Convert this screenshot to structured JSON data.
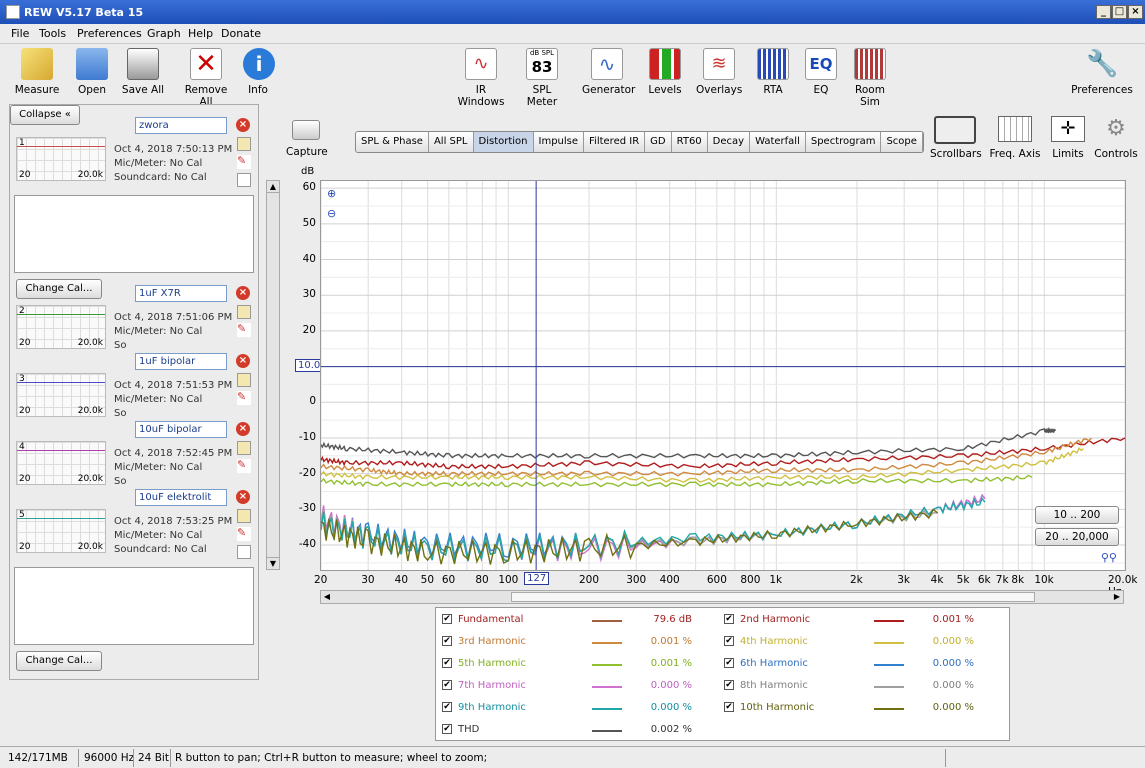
{
  "window": {
    "title": "REW V5.17 Beta 15"
  },
  "menu": [
    "File",
    "Tools",
    "Preferences",
    "Graph",
    "Help",
    "Donate"
  ],
  "toolbar": {
    "left": [
      "Measure",
      "Open",
      "Save All",
      "Remove All",
      "Info"
    ],
    "center": [
      "IR Windows",
      "SPL Meter",
      "Generator",
      "Levels",
      "Overlays",
      "RTA",
      "EQ",
      "Room Sim"
    ],
    "spl_badge_top": "dB SPL",
    "spl_badge_value": "83",
    "eq_badge": "EQ",
    "preferences": "Preferences"
  },
  "left_panel": {
    "collapse": "Collapse",
    "change_cal": "Change Cal...",
    "measurements": [
      {
        "name": "zwora",
        "num": "1",
        "date": "Oct 4, 2018 7:50:13 PM",
        "mic": "Mic/Meter: No Cal",
        "sound": "Soundcard: No Cal",
        "color": "#c45050"
      },
      {
        "name": "1uF X7R",
        "num": "2",
        "date": "Oct 4, 2018 7:51:06 PM",
        "mic": "Mic/Meter: No Cal",
        "sound": "So",
        "color": "#3a9a3a"
      },
      {
        "name": "1uF bipolar",
        "num": "3",
        "date": "Oct 4, 2018 7:51:53 PM",
        "mic": "Mic/Meter: No Cal",
        "sound": "So",
        "color": "#4a4ac8"
      },
      {
        "name": "10uF bipolar",
        "num": "4",
        "date": "Oct 4, 2018 7:52:45 PM",
        "mic": "Mic/Meter: No Cal",
        "sound": "So",
        "color": "#b040b0"
      },
      {
        "name": "10uF elektrolit",
        "num": "5",
        "date": "Oct 4, 2018 7:53:25 PM",
        "mic": "Mic/Meter: No Cal",
        "sound": "Soundcard: No Cal",
        "color": "#30a0a0"
      }
    ],
    "thumb_xmin": "20",
    "thumb_xmax": "20.0k"
  },
  "capture": "Capture",
  "tabs": [
    "SPL & Phase",
    "All SPL",
    "Distortion",
    "Impulse",
    "Filtered IR",
    "GD",
    "RT60",
    "Decay",
    "Waterfall",
    "Spectrogram",
    "Scope"
  ],
  "active_tab": "Distortion",
  "right_tools": [
    "Scrollbars",
    "Freq. Axis",
    "Limits",
    "Controls"
  ],
  "range_buttons": [
    "10 .. 200",
    "20 .. 20,000"
  ],
  "chart_data": {
    "type": "line",
    "ylabel": "dB",
    "xunit": "Hz",
    "xscale": "log",
    "xlim": [
      20,
      20000
    ],
    "ylim": [
      -47,
      62
    ],
    "yticks": [
      60,
      50,
      40,
      30,
      20,
      10,
      0,
      -10,
      -20,
      -30,
      -40
    ],
    "ytick_labels": [
      "60",
      "50",
      "40",
      "30",
      "20",
      "",
      "0",
      "-10",
      "-20",
      "-30",
      "-40"
    ],
    "xticks": [
      20,
      30,
      40,
      50,
      60,
      80,
      100,
      200,
      300,
      400,
      600,
      800,
      1000,
      2000,
      3000,
      4000,
      5000,
      6000,
      7000,
      8000,
      10000,
      20000
    ],
    "xtick_labels": [
      "20",
      "30",
      "40",
      "50",
      "60",
      "80",
      "100",
      "200",
      "300",
      "400",
      "600",
      "800",
      "1k",
      "2k",
      "3k",
      "4k",
      "5k",
      "6k",
      "7k",
      "8k",
      "10k",
      "20.0k Hz"
    ],
    "cursor": {
      "x": 127,
      "x_label": "127",
      "y": 10,
      "y_label": "10.0"
    },
    "grid": true,
    "series": [
      {
        "name": "THD",
        "color": "#555555",
        "x": [
          20,
          25,
          40,
          60,
          100,
          200,
          500,
          1000,
          2000,
          5000,
          10000,
          11000
        ],
        "y": [
          -12,
          -13,
          -14,
          -15,
          -15,
          -15,
          -15,
          -15,
          -14,
          -13,
          -8,
          -8
        ]
      },
      {
        "name": "2nd Harmonic",
        "color": "#b01c1c",
        "x": [
          20,
          25,
          40,
          60,
          100,
          200,
          500,
          1000,
          2000,
          5000,
          10000,
          20000
        ],
        "y": [
          -16,
          -17,
          -17,
          -18,
          -18,
          -17,
          -18,
          -17,
          -16,
          -15,
          -13,
          -10
        ]
      },
      {
        "name": "3rd Harmonic",
        "color": "#d08a40",
        "x": [
          20,
          30,
          40,
          60,
          100,
          200,
          500,
          1000,
          2000,
          5000,
          10000,
          15000
        ],
        "y": [
          -18,
          -19,
          -20,
          -20,
          -20,
          -20,
          -20,
          -19,
          -19,
          -17,
          -14,
          -10
        ]
      },
      {
        "name": "4th Harmonic",
        "color": "#d0c040",
        "x": [
          20,
          30,
          60,
          100,
          200,
          500,
          1000,
          2000,
          5000,
          10000,
          14000
        ],
        "y": [
          -20,
          -21,
          -21,
          -21,
          -21,
          -22,
          -21,
          -21,
          -19,
          -17,
          -13
        ]
      },
      {
        "name": "5th Harmonic",
        "color": "#90c030",
        "x": [
          20,
          30,
          60,
          100,
          200,
          500,
          1000,
          2000,
          5000,
          9000
        ],
        "y": [
          -22,
          -23,
          -23,
          -23,
          -23,
          -23,
          -23,
          -22,
          -22,
          -21
        ]
      },
      {
        "name": "6th Harmonic",
        "color": "#3080d0",
        "x": [
          20,
          30,
          50,
          100,
          200,
          500,
          1000,
          2000,
          4000,
          6000
        ],
        "y": [
          -33,
          -37,
          -40,
          -40,
          -40,
          -39,
          -37,
          -34,
          -30,
          -27
        ]
      },
      {
        "name": "7th Harmonic",
        "color": "#d070d0",
        "x": [
          20,
          30,
          50,
          100,
          200,
          500,
          1000,
          2000,
          4000,
          6000
        ],
        "y": [
          -32,
          -38,
          -41,
          -41,
          -41,
          -39,
          -37,
          -34,
          -30,
          -27
        ]
      },
      {
        "name": "8th Harmonic",
        "color": "#a0a0a0",
        "x": [
          20,
          30,
          50,
          100,
          200,
          500,
          1000,
          2000,
          4000
        ],
        "y": [
          -33,
          -38,
          -41,
          -41,
          -40,
          -39,
          -37,
          -34,
          -31
        ]
      },
      {
        "name": "9th Harmonic",
        "color": "#20a8a8",
        "x": [
          20,
          30,
          50,
          100,
          200,
          500,
          1000,
          2000,
          4000,
          6000
        ],
        "y": [
          -34,
          -38,
          -41,
          -41,
          -40,
          -38,
          -37,
          -34,
          -30,
          -28
        ]
      },
      {
        "name": "10th Harmonic",
        "color": "#707010",
        "x": [
          20,
          30,
          50,
          100,
          200,
          500,
          1000,
          2000,
          4000
        ],
        "y": [
          -35,
          -39,
          -42,
          -42,
          -41,
          -39,
          -37,
          -34,
          -31
        ]
      }
    ]
  },
  "legend": [
    {
      "name": "Fundamental",
      "value": "79.6 dB",
      "color": "#a06040",
      "textcolor": "#a02020"
    },
    {
      "name": "2nd Harmonic",
      "value": "0.001 %",
      "color": "#b01c1c",
      "textcolor": "#a02020"
    },
    {
      "name": "3rd Harmonic",
      "value": "0.001 %",
      "color": "#d08a40",
      "textcolor": "#c07830"
    },
    {
      "name": "4th Harmonic",
      "value": "0.000 %",
      "color": "#d0c040",
      "textcolor": "#c0b030"
    },
    {
      "name": "5th Harmonic",
      "value": "0.001 %",
      "color": "#90c030",
      "textcolor": "#80b020"
    },
    {
      "name": "6th Harmonic",
      "value": "0.000 %",
      "color": "#3080d0",
      "textcolor": "#3070c0"
    },
    {
      "name": "7th Harmonic",
      "value": "0.000 %",
      "color": "#d070d0",
      "textcolor": "#c060c0"
    },
    {
      "name": "8th Harmonic",
      "value": "0.000 %",
      "color": "#a0a0a0",
      "textcolor": "#808080"
    },
    {
      "name": "9th Harmonic",
      "value": "0.000 %",
      "color": "#20a8a8",
      "textcolor": "#1090a0"
    },
    {
      "name": "10th Harmonic",
      "value": "0.000 %",
      "color": "#707010",
      "textcolor": "#606010"
    },
    {
      "name": "THD",
      "value": "0.002 %",
      "color": "#555555",
      "textcolor": "#333333"
    }
  ],
  "status": {
    "memory": "142/171MB",
    "rate": "96000 Hz",
    "bits": "24 Bit",
    "hint": "R button to pan; Ctrl+R button to measure; wheel to zoom;"
  }
}
